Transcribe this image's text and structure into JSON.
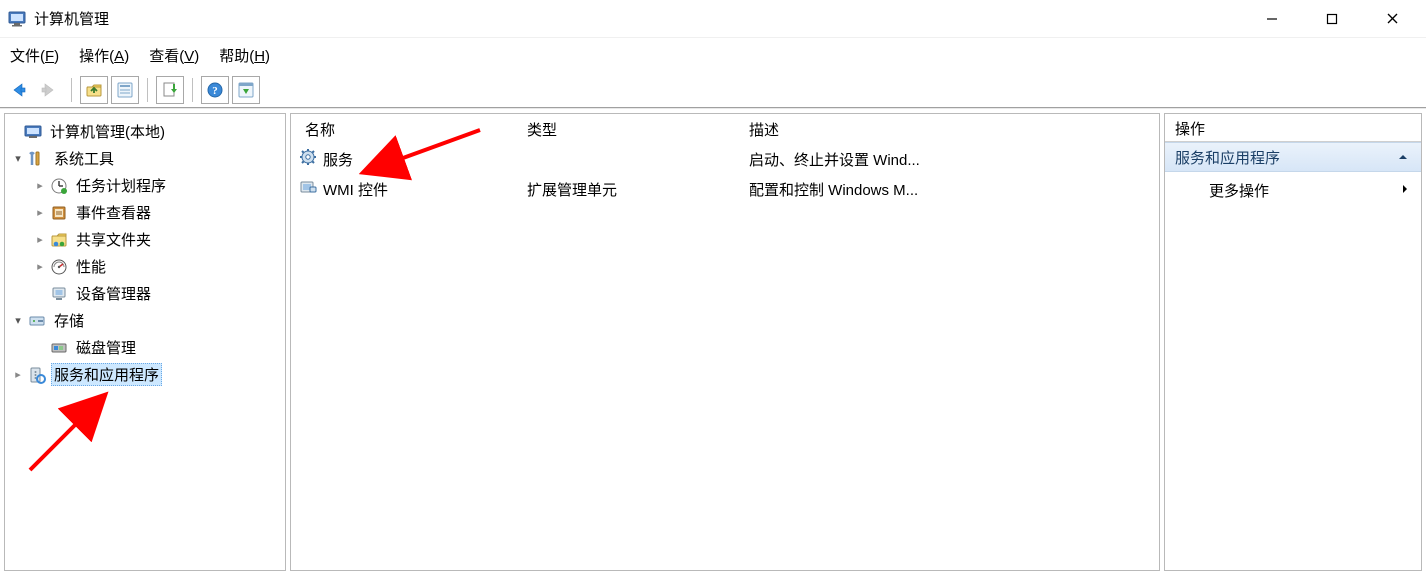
{
  "window": {
    "title": "计算机管理"
  },
  "menu": {
    "file": "文件(F)",
    "action": "操作(A)",
    "view": "查看(V)",
    "help": "帮助(H)"
  },
  "tree": {
    "root": "计算机管理(本地)",
    "system_tools": "系统工具",
    "task_scheduler": "任务计划程序",
    "event_viewer": "事件查看器",
    "shared_folders": "共享文件夹",
    "performance": "性能",
    "device_manager": "设备管理器",
    "storage": "存储",
    "disk_management": "磁盘管理",
    "services_apps": "服务和应用程序"
  },
  "list": {
    "headers": {
      "name": "名称",
      "type": "类型",
      "desc": "描述"
    },
    "rows": [
      {
        "name": "服务",
        "type": "",
        "desc": "启动、终止并设置 Wind..."
      },
      {
        "name": "WMI 控件",
        "type": "扩展管理单元",
        "desc": "配置和控制 Windows M..."
      }
    ]
  },
  "actions": {
    "title": "操作",
    "section": "服务和应用程序",
    "more_actions": "更多操作"
  }
}
